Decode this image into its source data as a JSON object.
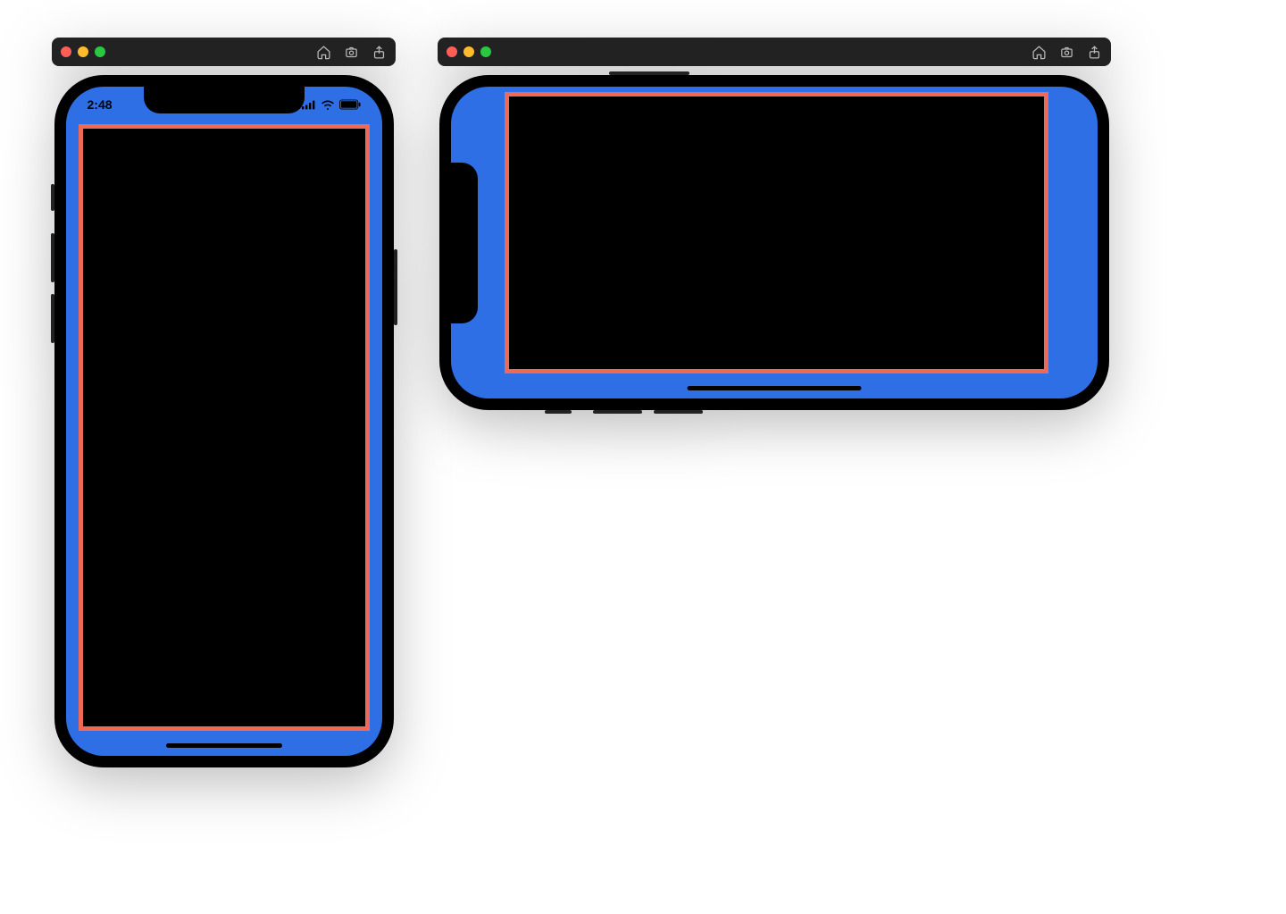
{
  "colors": {
    "safe_area_bg": "#2f6fe6",
    "content_border": "#ec6a56",
    "content_bg": "#000000"
  },
  "portrait": {
    "status_time": "2:48",
    "icons": {
      "cellular": "cellular-icon",
      "wifi": "wifi-icon",
      "battery": "battery-icon"
    }
  },
  "landscape": {},
  "toolbar_icons": {
    "home": "home-icon",
    "screenshot": "screenshot-icon",
    "share": "share-icon"
  }
}
